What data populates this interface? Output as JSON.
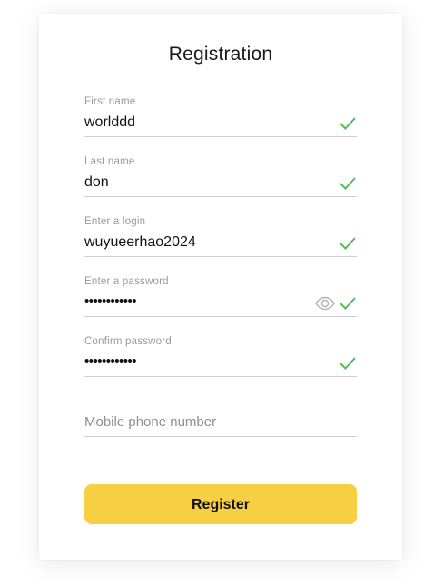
{
  "form": {
    "title": "Registration",
    "fields": [
      {
        "label": "First name",
        "value": "worlddd",
        "valid": true
      },
      {
        "label": "Last name",
        "value": "don",
        "valid": true
      },
      {
        "label": "Enter a login",
        "value": "wuyueerhao2024",
        "valid": true
      },
      {
        "label": "Enter a password",
        "value": "••••••••••••",
        "valid": true,
        "icon": "eye-icon"
      },
      {
        "label": "Confirm password",
        "value": "••••••••••••",
        "valid": true
      }
    ],
    "phone": {
      "placeholder": "Mobile phone number"
    },
    "register_label": "Register"
  },
  "colors": {
    "accent": "#f8ce43",
    "check": "#5bb85d",
    "line": "#cfcfcf",
    "label": "#9a9a9a"
  }
}
